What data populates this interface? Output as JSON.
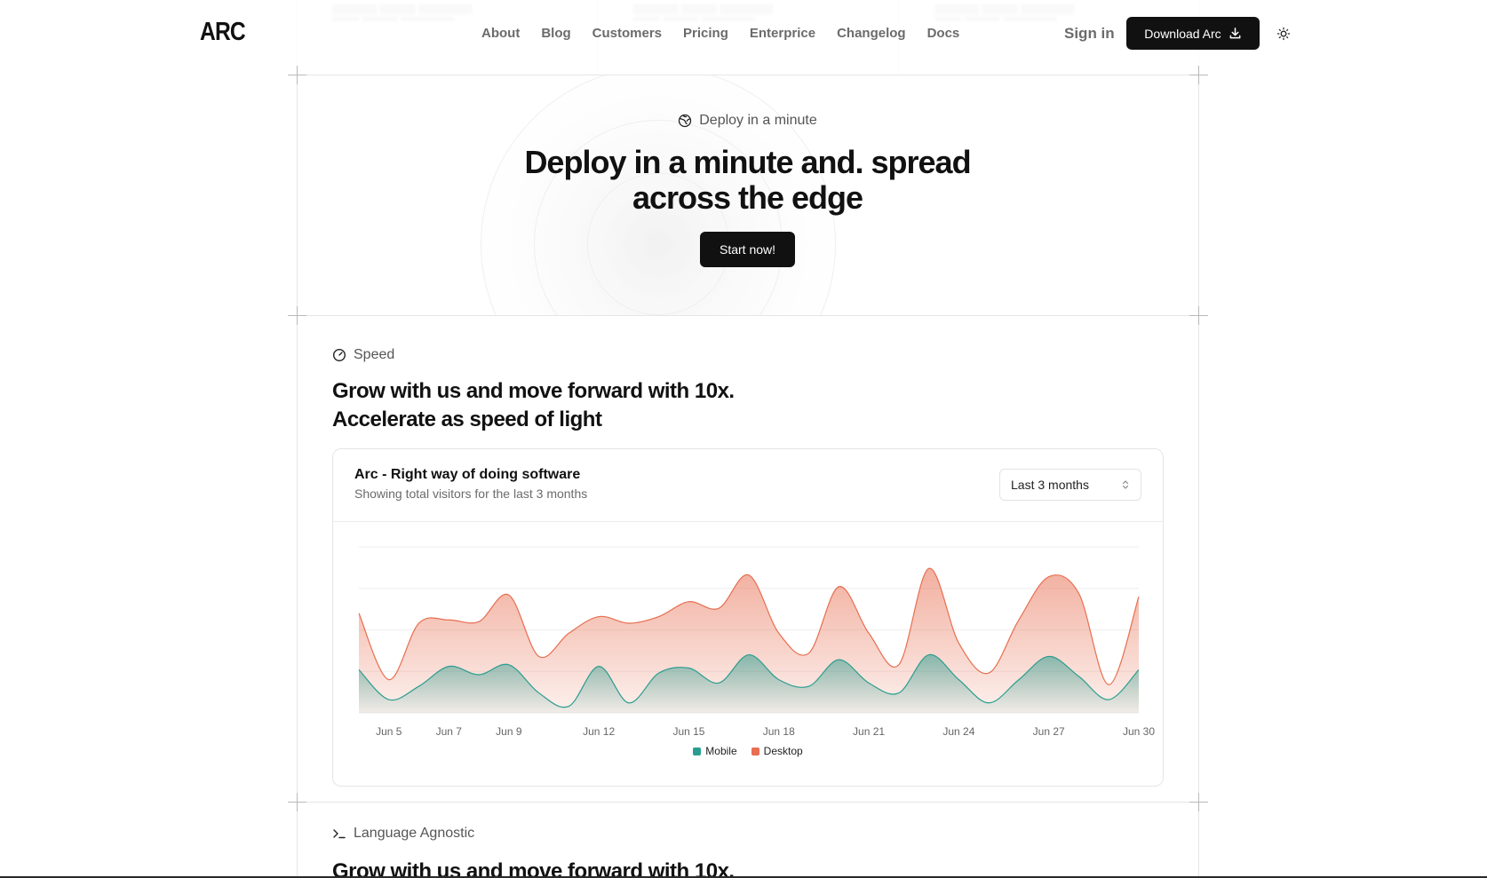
{
  "nav": {
    "logo": "ARC",
    "links": [
      "About",
      "Blog",
      "Customers",
      "Pricing",
      "Enterprice",
      "Changelog",
      "Docs"
    ],
    "sign_in": "Sign in",
    "download": "Download Arc",
    "theme_icon": "sun-icon"
  },
  "hero": {
    "pill": "Deploy in a minute",
    "title_regular": "Deploy in a minute and. ",
    "title_bold_1": "spread",
    "title_bold_2": "across the edge",
    "cta": "Start now!"
  },
  "speed": {
    "label": "Speed",
    "heading": "Grow with us and move forward with 10x.",
    "heading_bold": "Accelerate as speed of light",
    "card": {
      "title": "Arc - Right way of doing software",
      "subtitle": "Showing total visitors for the last 3 months",
      "range_select": "Last 3 months"
    }
  },
  "language": {
    "label": "Language Agnostic",
    "heading": "Grow with us and move forward with 10x."
  },
  "chart_data": {
    "type": "area",
    "stacked": true,
    "x_tick_labels": [
      "Jun 5",
      "Jun 7",
      "Jun 9",
      "Jun 12",
      "Jun 15",
      "Jun 18",
      "Jun 21",
      "Jun 24",
      "Jun 27",
      "Jun 30"
    ],
    "x": [
      4,
      5,
      6,
      7,
      8,
      9,
      10,
      11,
      12,
      13,
      14,
      15,
      16,
      17,
      18,
      19,
      20,
      21,
      22,
      23,
      24,
      25,
      26,
      27,
      28,
      29,
      30
    ],
    "series": [
      {
        "name": "Mobile",
        "color": "#2a9d8f",
        "values": [
          130,
          40,
          80,
          140,
          115,
          145,
          60,
          20,
          140,
          30,
          120,
          135,
          90,
          175,
          100,
          80,
          160,
          90,
          60,
          175,
          100,
          30,
          100,
          170,
          110,
          40,
          130
        ]
      },
      {
        "name": "Desktop",
        "color": "#e76e50",
        "values": [
          170,
          60,
          190,
          140,
          160,
          210,
          110,
          220,
          150,
          240,
          170,
          200,
          225,
          240,
          140,
          100,
          220,
          150,
          85,
          260,
          110,
          90,
          180,
          240,
          250,
          45,
          220
        ]
      }
    ],
    "ylim": [
      0,
      500
    ],
    "grid": true,
    "legend": "bottom-center"
  }
}
